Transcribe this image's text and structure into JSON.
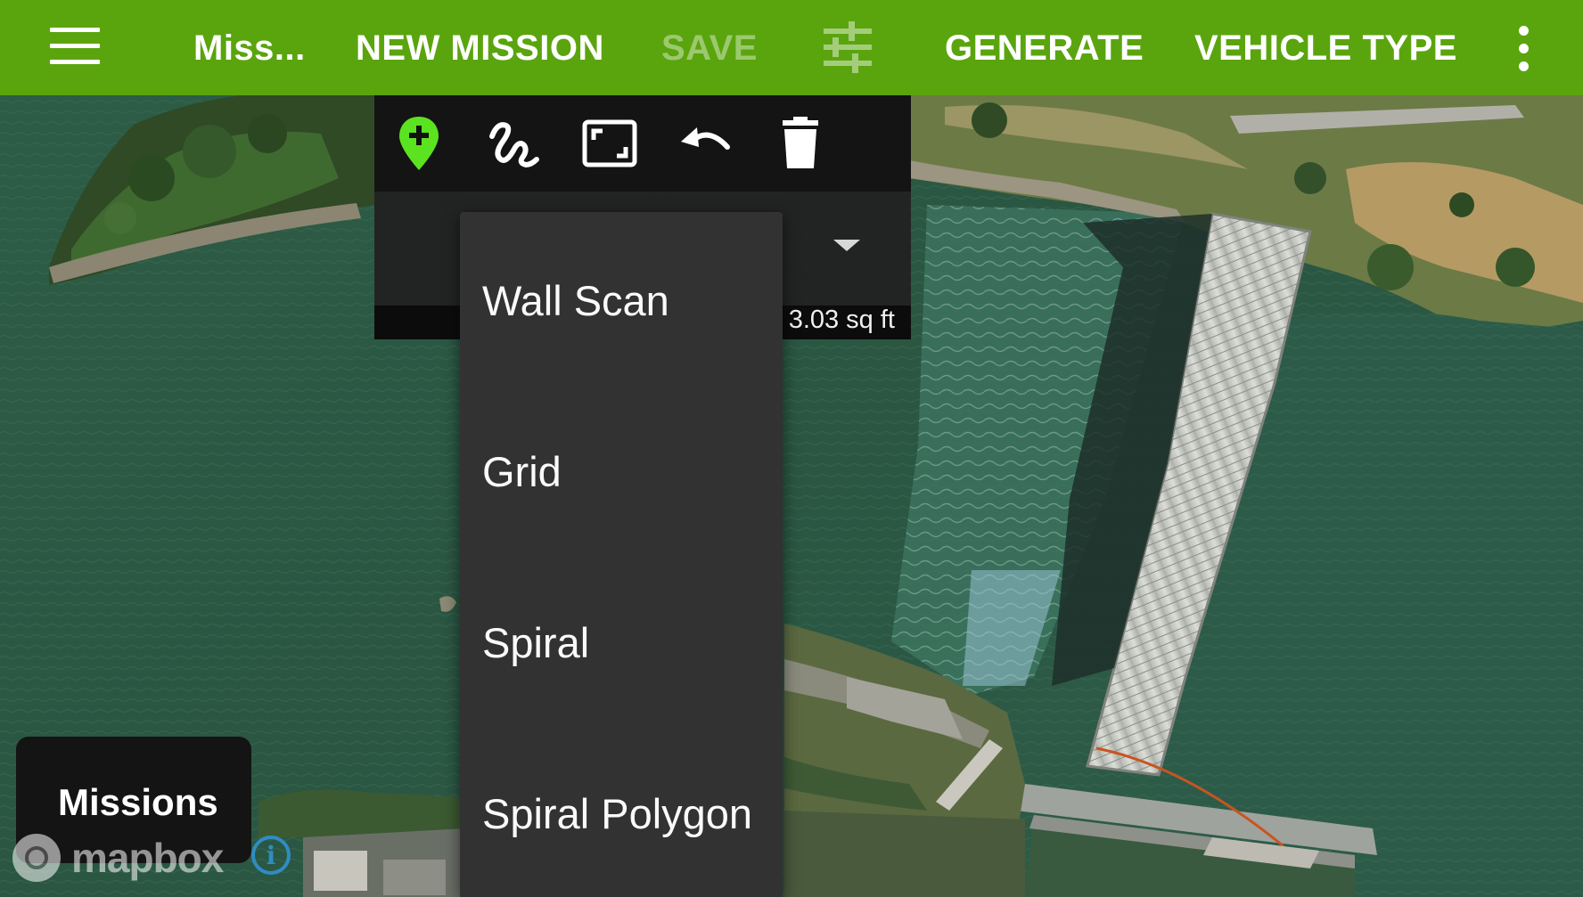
{
  "app_bar": {
    "title": "Miss...",
    "new_mission_label": "NEW MISSION",
    "save_label": "SAVE",
    "generate_label": "GENERATE",
    "vehicle_type_label": "VEHICLE TYPE",
    "icons": {
      "menu": "hamburger-menu-icon",
      "tune": "tune-sliders-icon",
      "overflow": "more-vertical-icon"
    },
    "color": "#5aa50e"
  },
  "panel": {
    "tools": [
      {
        "name": "add-waypoint-icon",
        "color": "#5be320"
      },
      {
        "name": "freehand-draw-icon"
      },
      {
        "name": "fit-to-screen-icon"
      },
      {
        "name": "undo-icon"
      },
      {
        "name": "delete-icon"
      }
    ],
    "area_text": "3.03 sq ft"
  },
  "pattern_menu": {
    "items": [
      "Wall Scan",
      "Grid",
      "Spiral",
      "Spiral Polygon"
    ]
  },
  "missions_button": {
    "label": "Missions"
  },
  "attribution": {
    "logo_text": "mapbox",
    "info_icon": "info-icon"
  }
}
